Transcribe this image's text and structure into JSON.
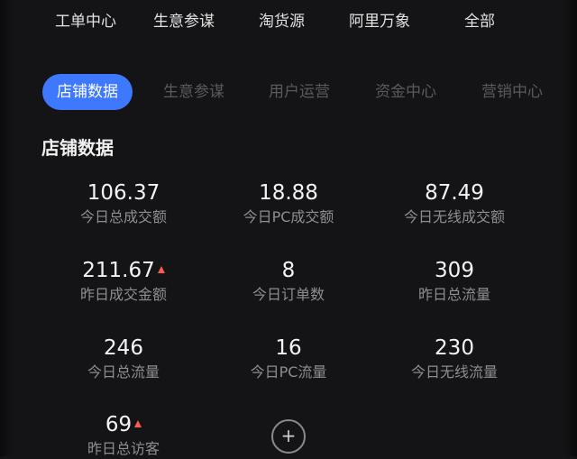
{
  "top_nav": [
    {
      "label": "工单中心"
    },
    {
      "label": "生意参谋"
    },
    {
      "label": "淘货源"
    },
    {
      "label": "阿里万象"
    },
    {
      "label": "全部"
    }
  ],
  "tabs": [
    {
      "label": "店铺数据",
      "active": true
    },
    {
      "label": "生意参谋"
    },
    {
      "label": "用户运营"
    },
    {
      "label": "资金中心"
    },
    {
      "label": "营销中心"
    }
  ],
  "section_title": "店铺数据",
  "metrics": [
    {
      "value": "106.37",
      "label": "今日总成交额"
    },
    {
      "value": "18.88",
      "label": "今日PC成交额"
    },
    {
      "value": "87.49",
      "label": "今日无线成交额"
    },
    {
      "value": "211.67",
      "label": "昨日成交金额",
      "trend": "up"
    },
    {
      "value": "8",
      "label": "今日订单数"
    },
    {
      "value": "309",
      "label": "昨日总流量"
    },
    {
      "value": "246",
      "label": "今日总流量"
    },
    {
      "value": "16",
      "label": "今日PC流量"
    },
    {
      "value": "230",
      "label": "今日无线流量"
    },
    {
      "value": "69",
      "label": "昨日总访客",
      "trend": "up"
    }
  ],
  "add_button": {
    "symbol": "+"
  },
  "colors": {
    "accent": "#3d78ff",
    "trend_up": "#ff5a4e",
    "background": "#141315"
  }
}
